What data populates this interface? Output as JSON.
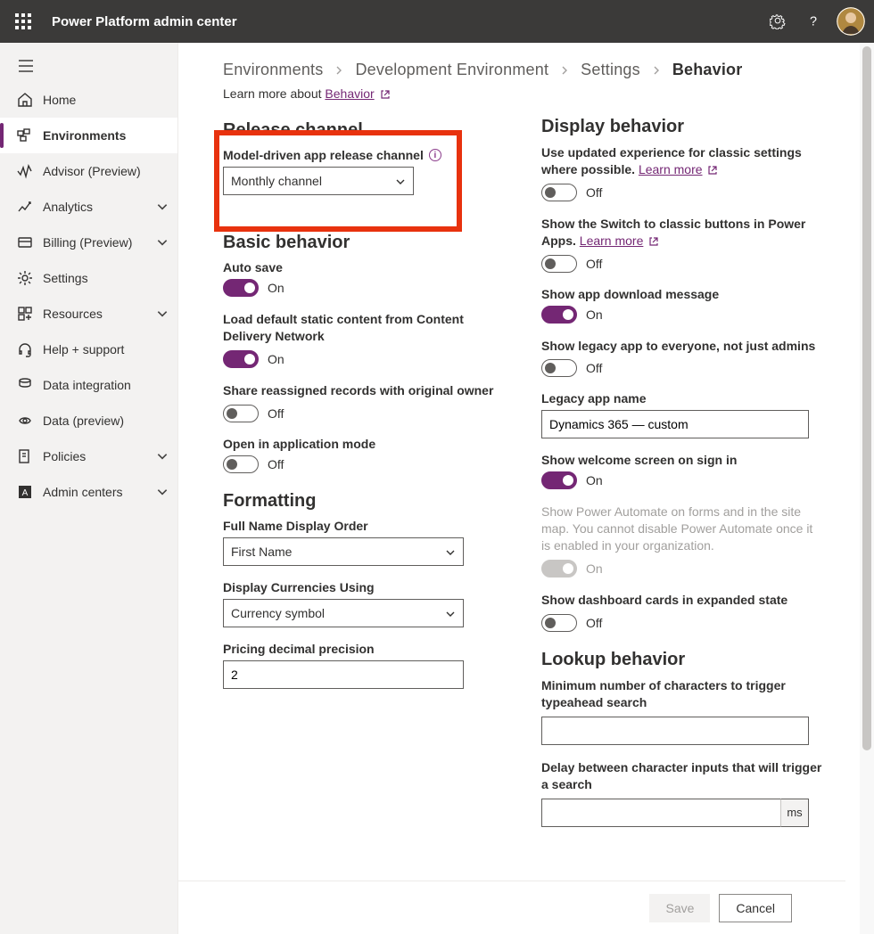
{
  "app_title": "Power Platform admin center",
  "nav": {
    "items": [
      {
        "label": "Home"
      },
      {
        "label": "Environments"
      },
      {
        "label": "Advisor (Preview)"
      },
      {
        "label": "Analytics",
        "chev": true
      },
      {
        "label": "Billing (Preview)",
        "chev": true
      },
      {
        "label": "Settings"
      },
      {
        "label": "Resources",
        "chev": true
      },
      {
        "label": "Help + support"
      },
      {
        "label": "Data integration"
      },
      {
        "label": "Data (preview)"
      },
      {
        "label": "Policies",
        "chev": true
      },
      {
        "label": "Admin centers",
        "chev": true
      }
    ]
  },
  "breadcrumb": {
    "items": [
      "Environments",
      "Development Environment",
      "Settings",
      "Behavior"
    ]
  },
  "learn_more_prefix": "Learn more about ",
  "learn_more_link": "Behavior",
  "left_col": {
    "release": {
      "heading": "Release channel",
      "field_label": "Model-driven app release channel",
      "select_value": "Monthly channel"
    },
    "basic": {
      "heading": "Basic behavior",
      "auto_save": {
        "label": "Auto save",
        "state": "On"
      },
      "cdn": {
        "label": "Load default static content from Content Delivery Network",
        "state": "On"
      },
      "share": {
        "label": "Share reassigned records with original owner",
        "state": "Off"
      },
      "open_app": {
        "label": "Open in application mode",
        "state": "Off"
      }
    },
    "formatting": {
      "heading": "Formatting",
      "name_order": {
        "label": "Full Name Display Order",
        "value": "First Name"
      },
      "currency": {
        "label": "Display Currencies Using",
        "value": "Currency symbol"
      },
      "precision": {
        "label": "Pricing decimal precision",
        "value": "2"
      }
    }
  },
  "right_col": {
    "display": {
      "heading": "Display behavior",
      "updated_exp": {
        "label": "Use updated experience for classic settings where possible. ",
        "link": "Learn more",
        "state": "Off"
      },
      "switch_classic": {
        "label": "Show the Switch to classic buttons in Power Apps. ",
        "link": "Learn more",
        "state": "Off"
      },
      "download_msg": {
        "label": "Show app download message",
        "state": "On"
      },
      "legacy_everyone": {
        "label": "Show legacy app to everyone, not just admins",
        "state": "Off"
      },
      "legacy_name": {
        "label": "Legacy app name",
        "value": "Dynamics 365 — custom"
      },
      "welcome": {
        "label": "Show welcome screen on sign in",
        "state": "On"
      },
      "pa_forms": {
        "label": "Show Power Automate on forms and in the site map. You cannot disable Power Automate once it is enabled in your organization.",
        "state": "On"
      },
      "dashboard": {
        "label": "Show dashboard cards in expanded state",
        "state": "Off"
      }
    },
    "lookup": {
      "heading": "Lookup behavior",
      "min_chars": {
        "label": "Minimum number of characters to trigger typeahead search",
        "value": ""
      },
      "delay": {
        "label": "Delay between character inputs that will trigger a search",
        "value": "",
        "suffix": "ms"
      }
    }
  },
  "footer": {
    "save": "Save",
    "cancel": "Cancel"
  }
}
